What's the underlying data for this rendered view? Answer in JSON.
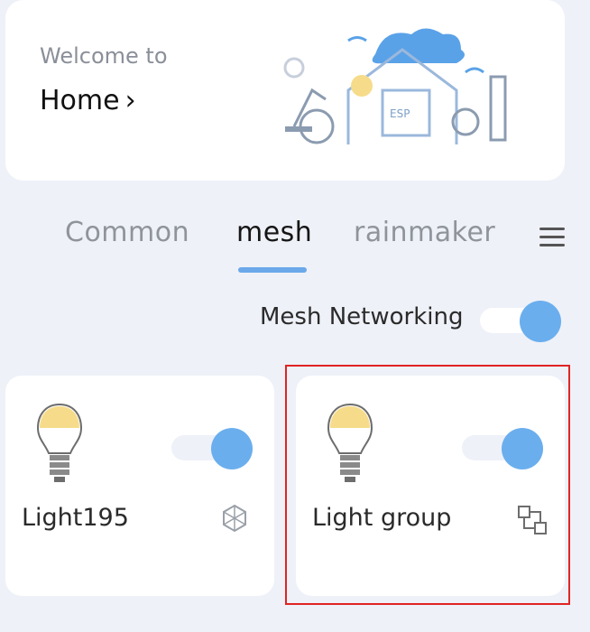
{
  "header": {
    "welcome_text": "Welcome to",
    "home_label": "Home",
    "chevron": "›",
    "illustration_chip_text": "ESP"
  },
  "tabs": [
    {
      "label": "Common",
      "active": false
    },
    {
      "label": "mesh",
      "active": true
    },
    {
      "label": "rainmaker",
      "active": false
    }
  ],
  "menu_icon": "hamburger-menu-icon",
  "mesh_networking": {
    "label": "Mesh Networking",
    "enabled": true
  },
  "devices": [
    {
      "name": "Light195",
      "on": true,
      "type_icon": "mesh-network-icon"
    },
    {
      "name": "Light group",
      "on": true,
      "type_icon": "group-icon",
      "highlighted": true
    }
  ],
  "colors": {
    "accent": "#6aaeee",
    "background": "#eef1f8",
    "highlight": "#e02424",
    "bulb_top": "#f6dc8a"
  }
}
